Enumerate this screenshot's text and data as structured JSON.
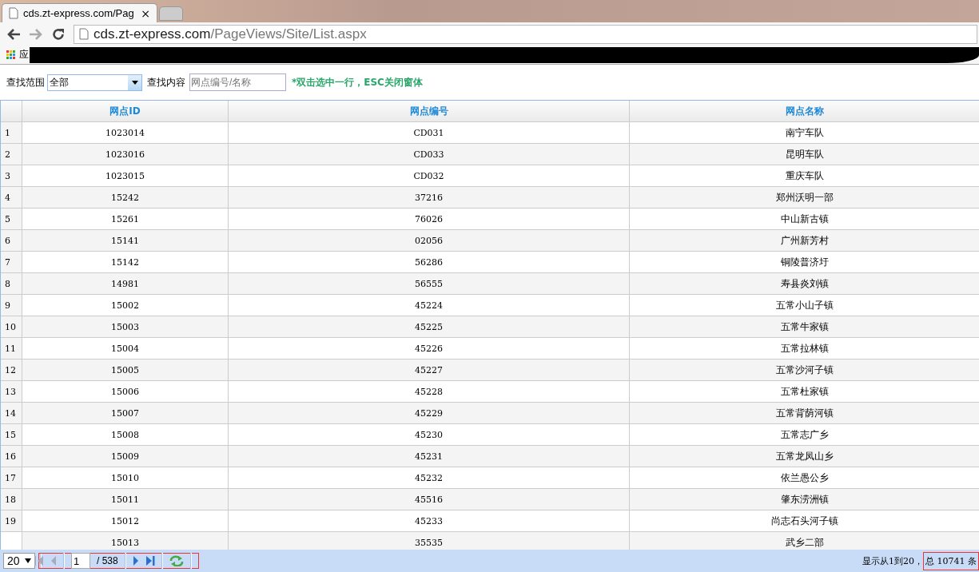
{
  "browser": {
    "tabs": [
      {
        "title": "cds.zt-express.com/Pag",
        "selected": true,
        "close": "×"
      },
      {
        "selected": false
      }
    ],
    "address": {
      "host": "cds.zt-express.com",
      "path": "/PageViews/Site/List.aspx"
    },
    "bookmarks": {
      "apps_label": "应"
    }
  },
  "toolbar": {
    "scope_label": "查找范围",
    "scope_value": "全部",
    "content_label": "查找内容",
    "content_placeholder": "网点编号/名称",
    "hint": "*双击选中一行，ESC关闭窗体"
  },
  "table": {
    "columns": [
      "网点ID",
      "网点编号",
      "网点名称"
    ],
    "rows": [
      {
        "number": "1",
        "id": "1023014",
        "code": "CD031",
        "name": "南宁车队"
      },
      {
        "number": "2",
        "id": "1023016",
        "code": "CD033",
        "name": "昆明车队"
      },
      {
        "number": "3",
        "id": "1023015",
        "code": "CD032",
        "name": "重庆车队"
      },
      {
        "number": "4",
        "id": "15242",
        "code": "37216",
        "name": "郑州沃明一部"
      },
      {
        "number": "5",
        "id": "15261",
        "code": "76026",
        "name": "中山新古镇"
      },
      {
        "number": "6",
        "id": "15141",
        "code": "02056",
        "name": "广州新芳村"
      },
      {
        "number": "7",
        "id": "15142",
        "code": "56286",
        "name": "铜陵普济圩"
      },
      {
        "number": "8",
        "id": "14981",
        "code": "56555",
        "name": "寿县炎刘镇"
      },
      {
        "number": "9",
        "id": "15002",
        "code": "45224",
        "name": "五常小山子镇"
      },
      {
        "number": "10",
        "id": "15003",
        "code": "45225",
        "name": "五常牛家镇"
      },
      {
        "number": "11",
        "id": "15004",
        "code": "45226",
        "name": "五常拉林镇"
      },
      {
        "number": "12",
        "id": "15005",
        "code": "45227",
        "name": "五常沙河子镇"
      },
      {
        "number": "13",
        "id": "15006",
        "code": "45228",
        "name": "五常杜家镇"
      },
      {
        "number": "14",
        "id": "15007",
        "code": "45229",
        "name": "五常背荫河镇"
      },
      {
        "number": "15",
        "id": "15008",
        "code": "45230",
        "name": "五常志广乡"
      },
      {
        "number": "16",
        "id": "15009",
        "code": "45231",
        "name": "五常龙凤山乡"
      },
      {
        "number": "17",
        "id": "15010",
        "code": "45232",
        "name": "依兰愚公乡"
      },
      {
        "number": "18",
        "id": "15011",
        "code": "45516",
        "name": "肇东涝洲镇"
      },
      {
        "number": "19",
        "id": "15012",
        "code": "45233",
        "name": "尚志石头河子镇"
      },
      {
        "id": "15013",
        "code": "35535",
        "name": "武乡二部"
      }
    ]
  },
  "pager": {
    "page_size": "20",
    "page": "1",
    "total_pages": "/ 538",
    "summary": "显示从1到20，",
    "total": "总 10741 条"
  }
}
